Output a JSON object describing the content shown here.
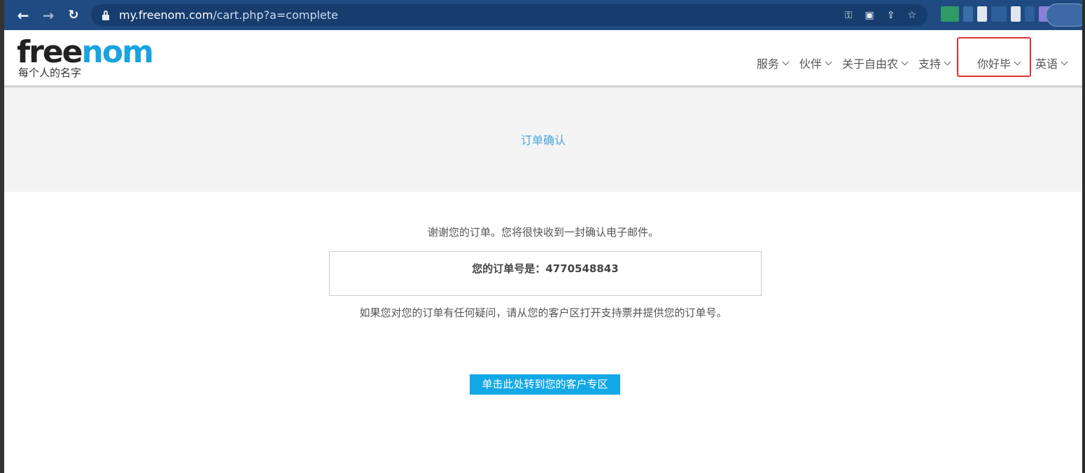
{
  "browser": {
    "url_host": "my.freenom.com",
    "url_path": "/cart.php?a=complete",
    "icons": [
      "back-icon",
      "forward-icon",
      "reload-icon",
      "lock-icon",
      "key-icon",
      "translate-icon",
      "share-icon",
      "star-icon"
    ]
  },
  "site": {
    "logo_free": "free",
    "logo_nom": "nom",
    "logo_tagline": "每个人的名字",
    "brand_color": "#19a3df"
  },
  "nav": {
    "services": "服务",
    "partners": "伙伴",
    "about": "关于自由农",
    "support": "支持",
    "user": "你好毕",
    "language": "英语"
  },
  "banner": {
    "title": "订单确认"
  },
  "content": {
    "thanks": "谢谢您的订单。您将很快收到一封确认电子邮件。",
    "order_label": "您的订单号是：",
    "order_number": "4770548843",
    "help": "如果您对您的订单有任何疑问，请从您的客户区打开支持票并提供您的订单号。",
    "cta": "单击此处转到您的客户专区"
  },
  "colors": {
    "toolbar": "#1f4a82",
    "button": "#13a8e6",
    "highlight": "#e53030"
  }
}
